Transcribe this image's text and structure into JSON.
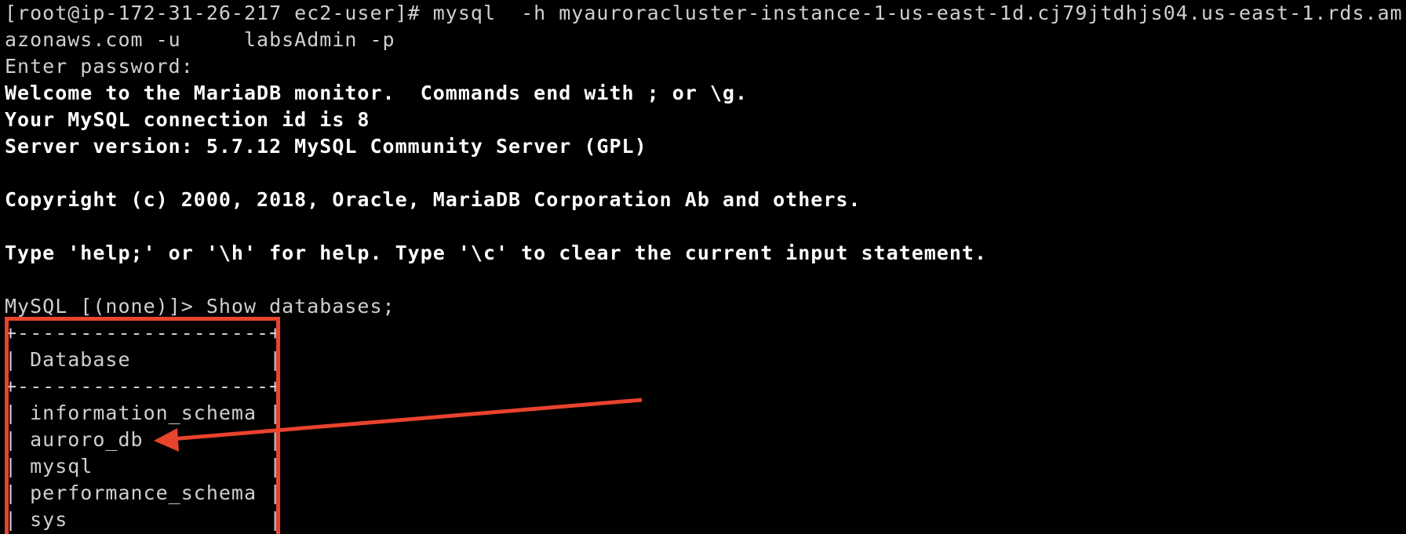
{
  "terminal": {
    "lines": [
      "[root@ip-172-31-26-217 ec2-user]# mysql  -h myauroracluster-instance-1-us-east-1d.cj79jtdhjs04.us-east-1.rds.am",
      "azonaws.com -u     labsAdmin -p",
      "Enter password:",
      "Welcome to the MariaDB monitor.  Commands end with ; or \\g.",
      "Your MySQL connection id is 8",
      "Server version: 5.7.12 MySQL Community Server (GPL)",
      "",
      "Copyright (c) 2000, 2018, Oracle, MariaDB Corporation Ab and others.",
      "",
      "Type 'help;' or '\\h' for help. Type '\\c' to clear the current input statement.",
      "",
      "MySQL [(none)]> Show databases;",
      "+--------------------+",
      "| Database           |",
      "+--------------------+",
      "| information_schema |",
      "| auroro_db          |",
      "| mysql              |",
      "| performance_schema |",
      "| sys                |"
    ]
  },
  "annotations": {
    "highlight_color": "#e8432d",
    "arrow_color": "#e8432d"
  }
}
